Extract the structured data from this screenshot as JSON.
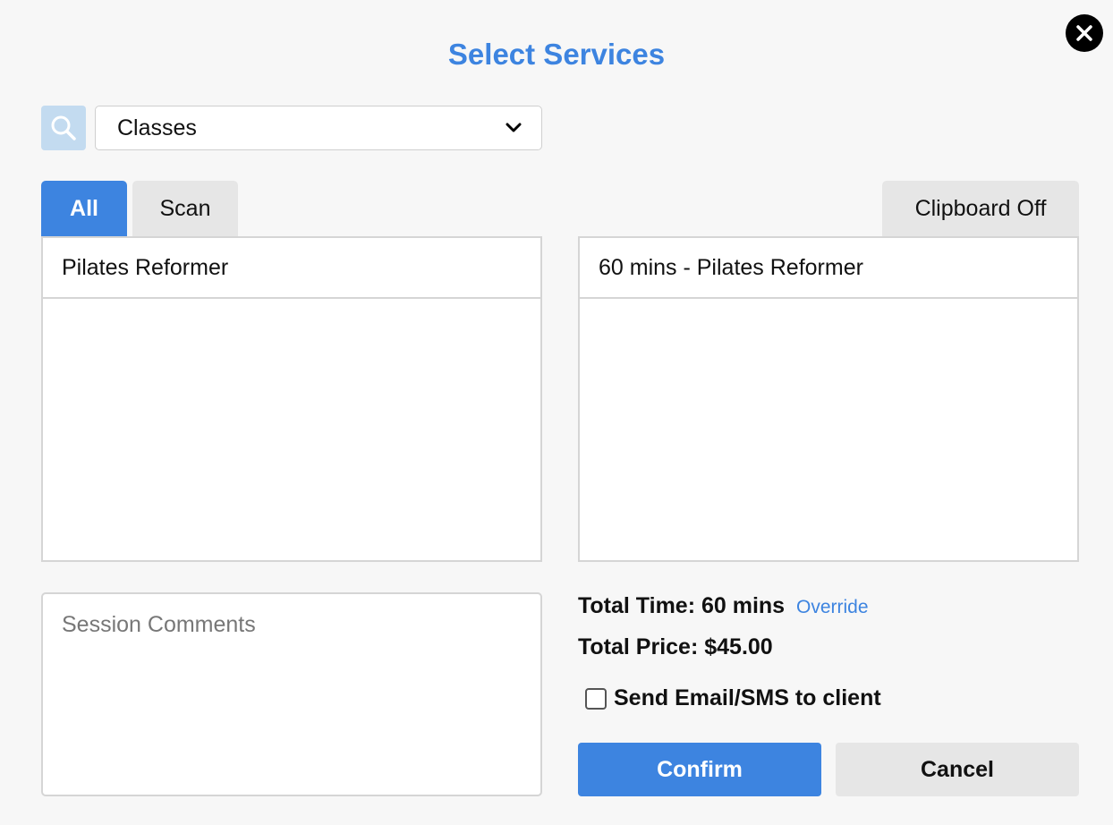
{
  "title": "Select Services",
  "search": {
    "icon": "search-icon",
    "selected_category": "Classes"
  },
  "tabs": [
    {
      "label": "All",
      "active": true
    },
    {
      "label": "Scan",
      "active": false
    }
  ],
  "clipboard_label": "Clipboard Off",
  "services_list": [
    "Pilates Reformer"
  ],
  "selected_list": [
    "60 mins - Pilates Reformer"
  ],
  "comments_placeholder": "Session Comments",
  "totals": {
    "time_label": "Total Time:",
    "time_value": "60 mins",
    "override_label": "Override",
    "price_label": "Total Price:",
    "price_value": "$45.00"
  },
  "notify_label": "Send Email/SMS to client",
  "notify_checked": false,
  "buttons": {
    "confirm": "Confirm",
    "cancel": "Cancel"
  },
  "colors": {
    "accent": "#3d84e0",
    "background": "#f7f7f7",
    "search_icon_bg": "#c3dbf0"
  }
}
